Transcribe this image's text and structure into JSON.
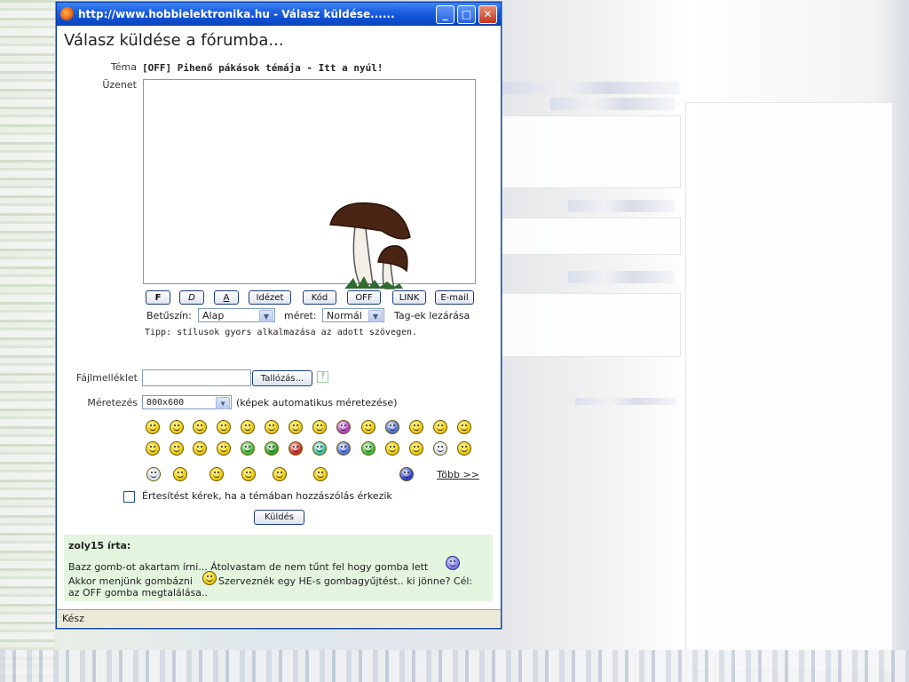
{
  "window": {
    "title": "http://www.hobbielektronika.hu - Válasz küldése......",
    "minimize_glyph": "_",
    "maximize_glyph": "□",
    "close_glyph": "✕",
    "status": "Kész"
  },
  "page": {
    "heading": "Válasz küldése a fórumba...",
    "topic_label": "Téma",
    "topic_value": "[OFF] Pihenő pákások témája - Itt a nyúl!",
    "message_label": "Üzenet"
  },
  "format_buttons": [
    "F",
    "D",
    "A",
    "Idézet",
    "Kód",
    "OFF",
    "LINK",
    "E-mail"
  ],
  "font_row": {
    "color_label": "Betűszín:",
    "color_value": "Alap",
    "size_label": "méret:",
    "size_value": "Normál",
    "close_tags": "Tag-ek lezárása"
  },
  "tip": "Tipp: stílusok gyors alkalmazása az adott szövegen.",
  "attachment": {
    "label": "Fájlmelléklet",
    "browse_label": "Tallózás...",
    "help_glyph": "?"
  },
  "resize": {
    "label": "Méretezés",
    "value": "800x600",
    "note": "(képek automatikus méretezése)"
  },
  "smilies": {
    "more_label": "Több >>",
    "icon_names": [
      "smile",
      "smile",
      "sad",
      "cool",
      "sad",
      "grin",
      "laugh",
      "tongue",
      "purple-devil",
      "wink",
      "blue-sad",
      "neutral",
      "sad",
      "sunglasses",
      "glasses",
      "confused",
      "question",
      "pacman",
      "green-sick",
      "green",
      "red-angry",
      "teal",
      "blue",
      "green-monster",
      "yellow",
      "thinking",
      "scared",
      "thumbs-up",
      "crying",
      "brick",
      "wizard",
      "fish",
      "cheers",
      "sign",
      "blue-hair"
    ]
  },
  "notify": {
    "label": "Értesítést kérek, ha a témában hozzászólás érkezik"
  },
  "send_label": "Küldés",
  "quote": {
    "author": "zoly15 írta:",
    "line1": "Bazz gomb-ot akartam írni... Átolvastam de nem tűnt fel hogy gomba lett",
    "line2": "Akkor menjünk gombázni",
    "line2b": "Szerveznék egy HE-s gombagyűjtést.. ki jönne? Cél:",
    "line3": "az OFF gomba megtalálása.."
  },
  "colors": {
    "titlebar": "#1d5fe0",
    "quote_bg": "#e3f5df",
    "mushroom_cap": "#4a2414"
  }
}
